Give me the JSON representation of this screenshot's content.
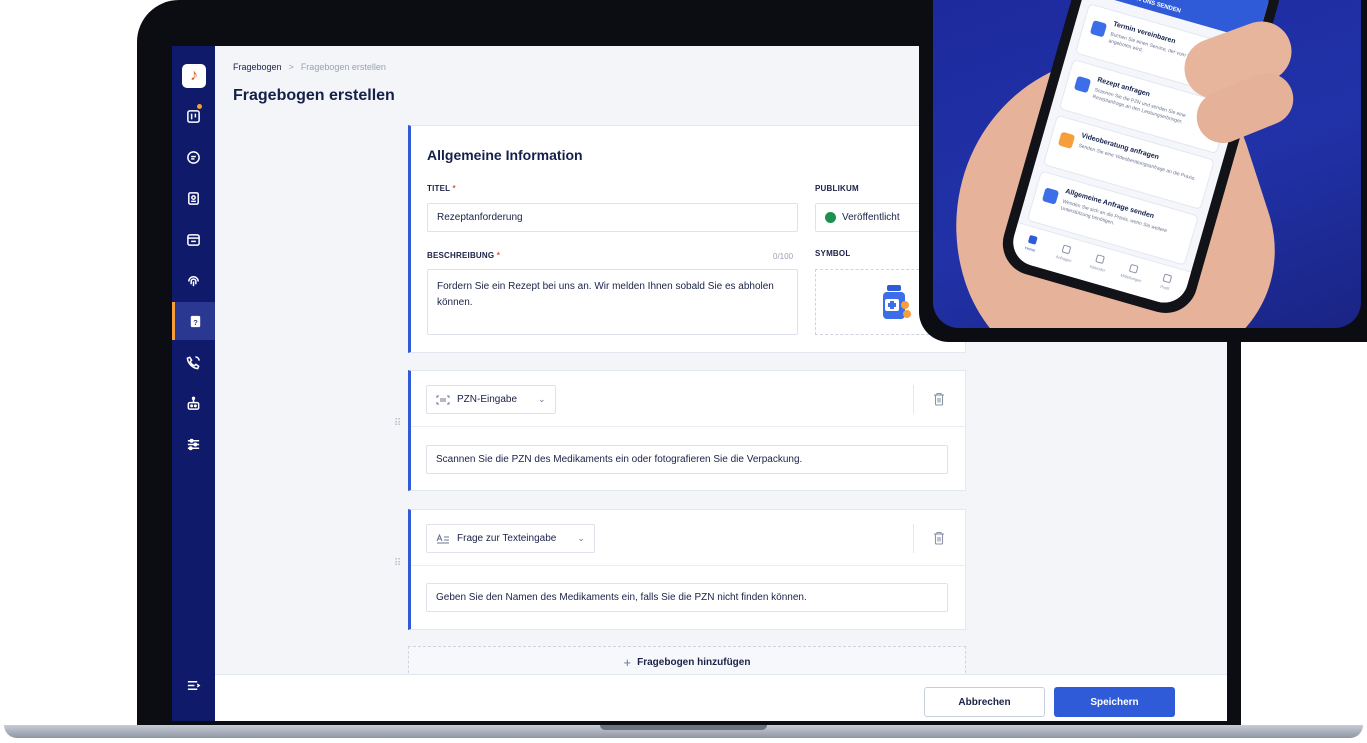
{
  "breadcrumb": {
    "parent": "Fragebogen",
    "separator": ">",
    "current": "Fragebogen erstellen"
  },
  "page_title": "Fragebogen erstellen",
  "general": {
    "title": "Allgemeine Information",
    "titel_label": "TITEL",
    "titel_value": "Rezeptanforderung",
    "publikum_label": "PUBLIKUM",
    "publikum_value": "Veröffentlicht",
    "beschreibung_label": "BESCHREIBUNG",
    "beschreibung_count": "0/100",
    "beschreibung_value": "Fordern Sie ein Rezept bei uns an. Wir melden Ihnen sobald Sie es abholen können.",
    "symbol_label": "SYMBOL",
    "required_mark": "*"
  },
  "questions": [
    {
      "type": "PZN-Eingabe",
      "type_icon": "barcode-scan-icon",
      "text": "Scannen Sie die PZN des Medikaments ein oder fotografieren Sie die Verpackung."
    },
    {
      "type": "Frage zur Texteingabe",
      "type_icon": "text-input-icon",
      "text": "Geben Sie den Namen des Medikaments ein, falls Sie die PZN nicht finden können."
    }
  ],
  "add_label": "Fragebogen hinzufügen",
  "add_icon": "+",
  "footer": {
    "cancel": "Abbrechen",
    "save": "Speichern"
  },
  "sidebar": {
    "logo": "♪",
    "items": [
      "board-icon",
      "chat-icon",
      "contact-icon",
      "calendar-icon",
      "fingerprint-icon",
      "questionnaire-icon",
      "phone-icon",
      "robot-icon",
      "settings-sliders-icon"
    ],
    "bottom": "menu-collapse-icon"
  },
  "colors": {
    "sidebar": "#0f1a6b",
    "accent": "#2f5bd8",
    "brand_orange": "#f59e3a",
    "required": "#e2513b"
  },
  "phone": {
    "header": "FRAGE AN UNS SENDEN",
    "cards": [
      {
        "title": "Termin vereinbaren",
        "text": "Buchen Sie einen Service, der vom Pflegedienstleister angeboten wird."
      },
      {
        "title": "Rezept anfragen",
        "text": "Scannen Sie die PZN und senden Sie eine Rezeptanfrage an den Leistungserbringer."
      },
      {
        "title": "Videoberatung anfragen",
        "text": "Senden Sie eine Videoberatungsanfrage an die Praxis."
      },
      {
        "title": "Allgemeine Anfrage senden",
        "text": "Wenden Sie sich an die Praxis, wenn Sie weitere Unterstützung benötigen."
      }
    ],
    "tabs": [
      "Home",
      "Anfragen",
      "Kalender",
      "Mitteilungen",
      "Profil"
    ]
  }
}
